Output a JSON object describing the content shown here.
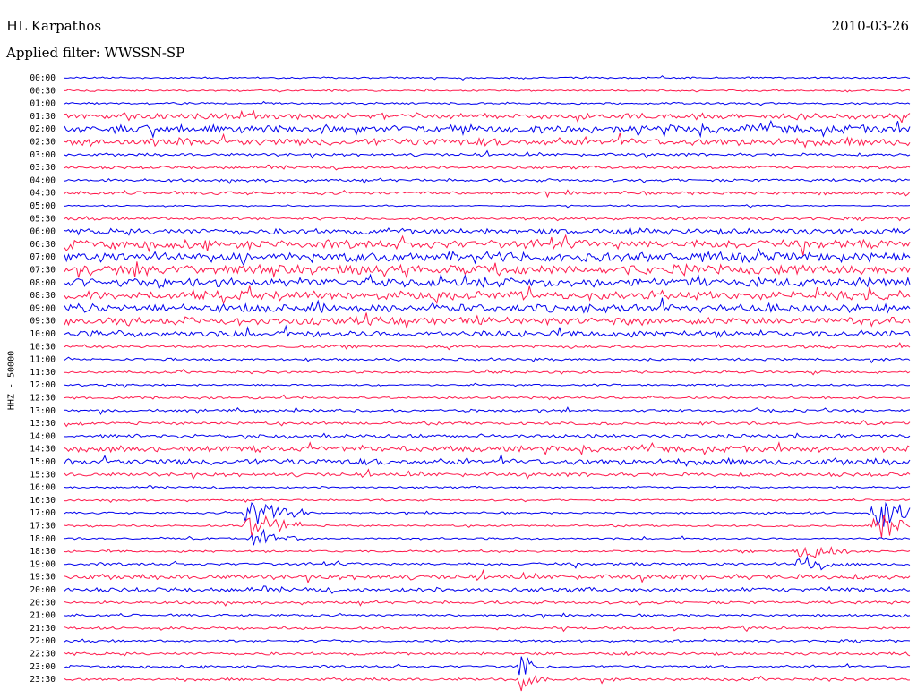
{
  "header": {
    "station": "HL Karpathos",
    "date": "2010-03-26",
    "filter": "Applied filter: WWSSN-SP"
  },
  "colors": {
    "a": "#0000ee",
    "b": "#ff1a4d"
  },
  "chart_data": {
    "type": "line",
    "title": "HL Karpathos",
    "ylabel": "HHZ - 50000",
    "rows": [
      "00:00",
      "00:30",
      "01:00",
      "01:30",
      "02:00",
      "02:30",
      "03:00",
      "03:30",
      "04:00",
      "04:30",
      "05:00",
      "05:30",
      "06:00",
      "06:30",
      "07:00",
      "07:30",
      "08:00",
      "08:30",
      "09:00",
      "09:30",
      "10:00",
      "10:30",
      "11:00",
      "11:30",
      "12:00",
      "12:30",
      "13:00",
      "13:30",
      "14:00",
      "14:30",
      "15:00",
      "15:30",
      "16:00",
      "16:30",
      "17:00",
      "17:30",
      "18:00",
      "18:30",
      "19:00",
      "19:30",
      "20:00",
      "20:30",
      "21:00",
      "21:30",
      "22:00",
      "22:30",
      "23:00",
      "23:30"
    ],
    "row_colors": [
      "a",
      "b"
    ],
    "noise_level": [
      0.35,
      0.35,
      0.4,
      1.2,
      1.6,
      1.6,
      0.6,
      0.6,
      0.6,
      0.7,
      0.25,
      0.6,
      1.2,
      1.8,
      2.0,
      2.0,
      1.9,
      1.8,
      1.7,
      1.6,
      1.3,
      0.6,
      0.5,
      0.5,
      0.4,
      0.5,
      0.55,
      0.6,
      0.8,
      1.2,
      1.3,
      0.8,
      0.4,
      0.4,
      0.4,
      0.4,
      0.4,
      0.45,
      0.6,
      1.0,
      0.9,
      0.6,
      0.5,
      0.5,
      0.5,
      0.6,
      0.5,
      0.6
    ],
    "events": [
      {
        "row": 34,
        "pos": 0.22,
        "amp": 7,
        "dur": 0.07
      },
      {
        "row": 35,
        "pos": 0.22,
        "amp": 6,
        "dur": 0.06
      },
      {
        "row": 36,
        "pos": 0.225,
        "amp": 4,
        "dur": 0.06
      },
      {
        "row": 34,
        "pos": 0.96,
        "amp": 8,
        "dur": 0.05
      },
      {
        "row": 35,
        "pos": 0.96,
        "amp": 6,
        "dur": 0.05
      },
      {
        "row": 37,
        "pos": 0.87,
        "amp": 3,
        "dur": 0.06
      },
      {
        "row": 38,
        "pos": 0.87,
        "amp": 2.5,
        "dur": 0.06
      },
      {
        "row": 46,
        "pos": 0.54,
        "amp": 5,
        "dur": 0.03
      },
      {
        "row": 47,
        "pos": 0.54,
        "amp": 4,
        "dur": 0.03
      }
    ]
  }
}
